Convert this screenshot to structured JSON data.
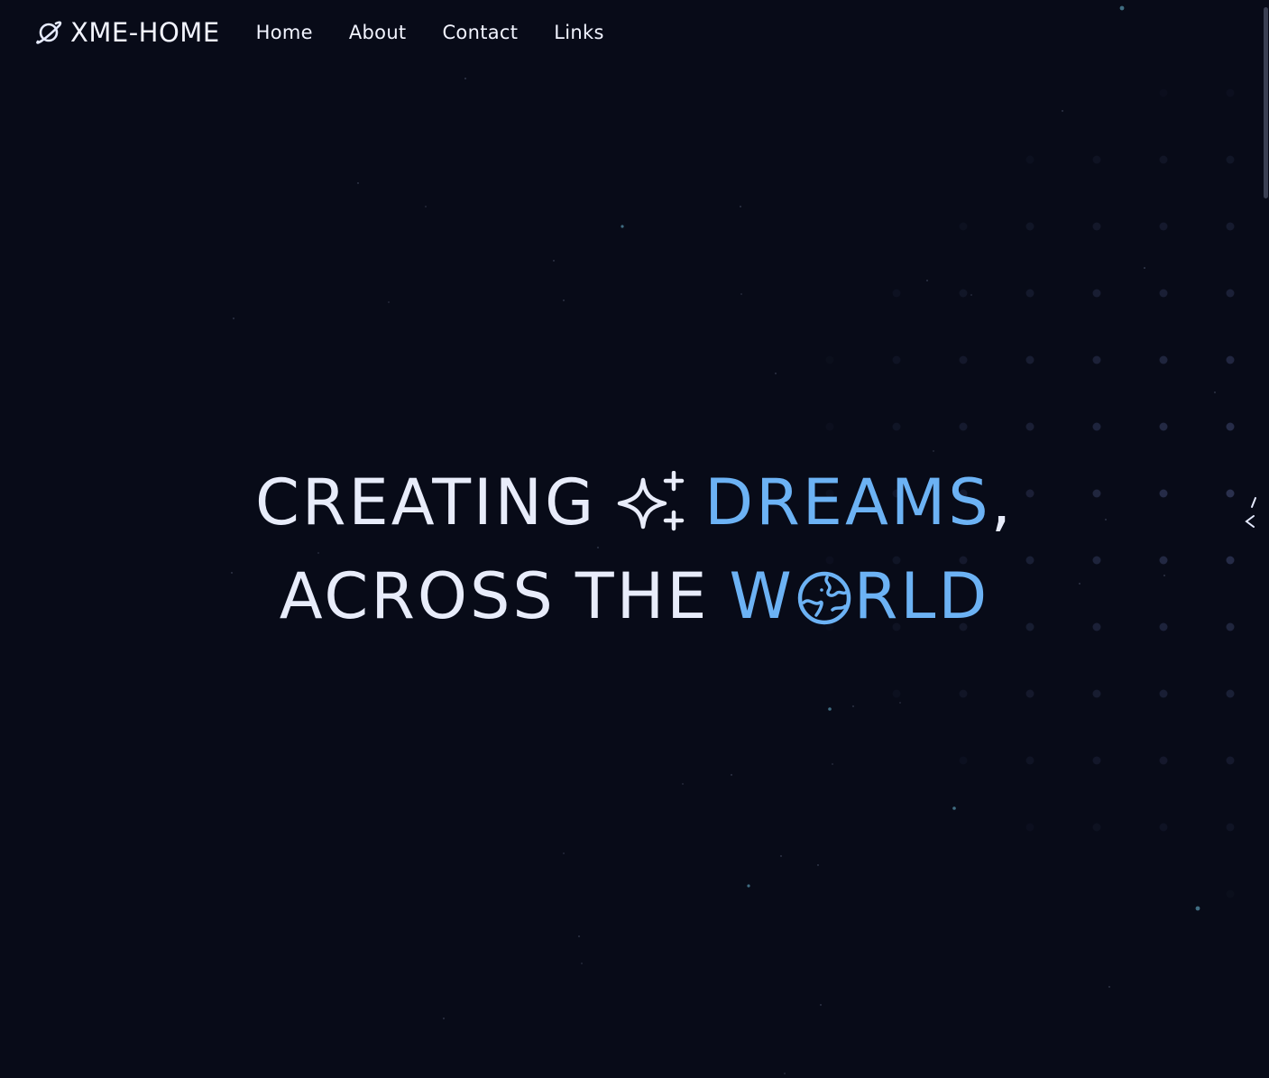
{
  "navbar": {
    "brand": {
      "icon": "planet-icon",
      "label": "XME-HOME"
    },
    "links": [
      {
        "label": "Home"
      },
      {
        "label": "About"
      },
      {
        "label": "Contact"
      },
      {
        "label": "Links"
      }
    ]
  },
  "hero": {
    "line1": {
      "word1": "CREATING",
      "icon": "sparkle-icon",
      "word2": "DREAMS",
      "punct": ","
    },
    "line2": {
      "word1": "ACROSS",
      "word2": "THE",
      "accent_before_icon": "W",
      "icon": "globe-icon",
      "accent_after_icon": "RLD"
    }
  },
  "colors": {
    "background": "#080b18",
    "text": "#e8ecfa",
    "accent": "#6cb2f4",
    "dot_grid": "#2b3250"
  }
}
